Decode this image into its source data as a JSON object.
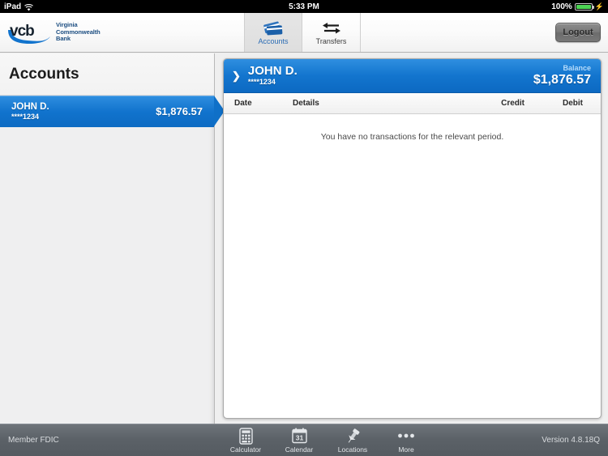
{
  "status_bar": {
    "device": "iPad",
    "wifi_icon": "wifi-icon",
    "time": "5:33 PM",
    "battery_percent": "100%",
    "battery_icon": "battery-full-charging-icon"
  },
  "brand": {
    "logo_mark": "vcb-logo-icon",
    "logo_wordmark": "vcb",
    "name_line1": "Virginia",
    "name_line2": "Commonwealth",
    "name_line3": "Bank",
    "accent_blue": "#1173cd",
    "logo_navy": "#1e2d3c"
  },
  "navbar": {
    "tabs": [
      {
        "label": "Accounts",
        "icon": "credit-cards-icon",
        "active": true
      },
      {
        "label": "Transfers",
        "icon": "transfer-arrows-icon",
        "active": false
      }
    ],
    "logout_label": "Logout"
  },
  "sidebar": {
    "title": "Accounts",
    "accounts": [
      {
        "name": "JOHN D.",
        "masked_number": "****1234",
        "balance": "$1,876.57",
        "selected": true
      }
    ]
  },
  "detail": {
    "chevron_icon": "chevron-right-icon",
    "account_name": "JOHN D.",
    "masked_number": "****1234",
    "balance_label": "Balance",
    "balance": "$1,876.57",
    "columns": {
      "date": "Date",
      "details": "Details",
      "credit": "Credit",
      "debit": "Debit"
    },
    "empty_message": "You have no transactions for the relevant period."
  },
  "toolbar": {
    "fdic": "Member FDIC",
    "version": "Version 4.8.18Q",
    "items": [
      {
        "label": "Calculator",
        "icon": "calculator-icon"
      },
      {
        "label": "Calendar",
        "icon": "calendar-icon",
        "day": "31"
      },
      {
        "label": "Locations",
        "icon": "pushpin-icon"
      },
      {
        "label": "More",
        "icon": "ellipsis-icon"
      }
    ]
  }
}
